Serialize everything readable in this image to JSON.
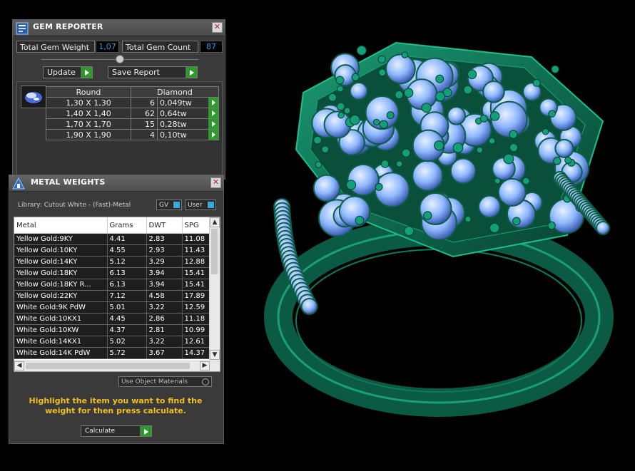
{
  "gem_reporter": {
    "title": "GEM REPORTER",
    "total_weight_label": "Total Gem Weight",
    "total_weight_value": "1,07",
    "total_count_label": "Total Gem Count",
    "total_count_value": "87",
    "update_label": "Update",
    "save_report_label": "Save Report",
    "header_shape": "Round",
    "header_type": "Diamond",
    "rows": [
      {
        "size": "1,30 X 1,30",
        "count": "6",
        "tw": "0,049tw"
      },
      {
        "size": "1,40 X 1,40",
        "count": "62",
        "tw": "0,64tw"
      },
      {
        "size": "1,70 X 1,70",
        "count": "15",
        "tw": "0,28tw"
      },
      {
        "size": "1,90 X 1,90",
        "count": "4",
        "tw": "0,10tw"
      }
    ]
  },
  "metal_weights": {
    "title": "METAL WEIGHTS",
    "library_label": "Library: Cutout White - (Fast)-Metal",
    "gv_label": "GV",
    "user_label": "User",
    "columns": [
      "Metal",
      "Grams",
      "DWT",
      "SPG"
    ],
    "rows": [
      [
        "Yellow Gold:9KY",
        "4.41",
        "2.83",
        "11.08"
      ],
      [
        "Yellow Gold:10KY",
        "4.55",
        "2.93",
        "11.43"
      ],
      [
        "Yellow Gold:14KY",
        "5.12",
        "3.29",
        "12.88"
      ],
      [
        "Yellow Gold:18KY",
        "6.13",
        "3.94",
        "15.41"
      ],
      [
        "Yellow Gold:18KY R...",
        "6.13",
        "3.94",
        "15.41"
      ],
      [
        "Yellow Gold:22KY",
        "7.12",
        "4.58",
        "17.89"
      ],
      [
        "White Gold:9K PdW",
        "5.01",
        "3.22",
        "12.59"
      ],
      [
        "White Gold:10KX1",
        "4.45",
        "2.86",
        "11.18"
      ],
      [
        "White Gold:10KW",
        "4.37",
        "2.81",
        "10.99"
      ],
      [
        "White Gold:14KX1",
        "5.02",
        "3.22",
        "12.61"
      ],
      [
        "White Gold:14K PdW",
        "5.72",
        "3.67",
        "14.37"
      ]
    ],
    "use_object_materials_label": "Use Object Materials",
    "hint": "Highlight the item you want to find the weight for then press calculate.",
    "calculate_label": "Calculate"
  },
  "colors": {
    "metal": "#0d6b4f",
    "gem": "#8fb8ff",
    "hint": "#f0c020",
    "accent_green": "#2e9a2e"
  }
}
